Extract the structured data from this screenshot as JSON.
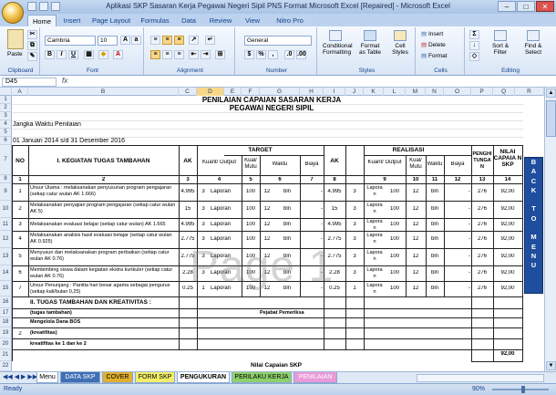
{
  "window": {
    "title": "Aplikasi SKP Sasaran Kerja Pegawai Negeri Sipil PNS Format Microsoft Excel [Repaired] - Microsoft Excel"
  },
  "ribbon_tabs": [
    "Home",
    "Insert",
    "Page Layout",
    "Formulas",
    "Data",
    "Review",
    "View",
    "Nitro Pro"
  ],
  "ribbon": {
    "paste": "Paste",
    "font_name": "Cambria",
    "font_size": "10",
    "number_format": "General",
    "groups": [
      "Clipboard",
      "Font",
      "Alignment",
      "Number",
      "Styles",
      "Cells",
      "Editing"
    ],
    "styles": [
      "Conditional Formatting",
      "Format as Table",
      "Cell Styles"
    ],
    "cells": [
      "Insert",
      "Delete",
      "Format"
    ],
    "editing": [
      "Sort & Filter",
      "Find & Select"
    ]
  },
  "formula_bar": {
    "name_box": "D45",
    "fx": "fx",
    "content": ""
  },
  "columns": [
    "A",
    "B",
    "C",
    "D",
    "E",
    "F",
    "G",
    "H",
    "I",
    "J",
    "K",
    "L",
    "M",
    "N",
    "O",
    "P",
    "Q",
    "R"
  ],
  "selected_column": "D",
  "rows": [
    "1",
    "2",
    "3",
    "4",
    "5",
    "6",
    "7",
    "8",
    "9",
    "10",
    "11",
    "12",
    "13",
    "14",
    "15",
    "16",
    "17",
    "18",
    "19",
    "20",
    "21",
    "22"
  ],
  "sheet": {
    "title1": "PENILAIAN CAPAIAN SASARAN KERJA",
    "title2": "PEGAWAI NEGERI SIPIL",
    "jangka_label": "Jangka Waktu Penilaian",
    "jangka_value": "01 Januari 2014 s/d 31 Desember 2016",
    "headers": {
      "no": "NO",
      "kegiatan": "I. KEGIATAN TUGAS TAMBAHAN",
      "ak": "AK",
      "target": "TARGET",
      "realisasi": "REALISASI",
      "kuant": "Kuant/ Output",
      "kual": "Kual/ Mutu",
      "waktu": "Waktu",
      "biaya": "Biaya",
      "penghitungan": "PENGHI TUNGA N",
      "nilai": "NILAI CAPAIA N SKP"
    },
    "colnums": [
      "1",
      "2",
      "3",
      "4",
      "5",
      "6",
      "7",
      "8",
      "9",
      "10",
      "11",
      "12",
      "13",
      "14"
    ],
    "tasks": [
      {
        "no": "1",
        "name": "Unsur Utama : melaksanakan penyusunan program pengajaran (setiap catur wulan AK 1.666)",
        "ak": "4.995",
        "kuant": "3",
        "unit": "Laporan",
        "kual": "100",
        "waktu": "12",
        "wunit": "bln",
        "biaya": "-",
        "rak": "4.995",
        "rkuant": "3",
        "runit": "Lapora n",
        "rkual": "100",
        "rwaktu": "12",
        "rwunit": "bln",
        "rbiaya": "-",
        "hitung": "276",
        "nilai": "92,00"
      },
      {
        "no": "2",
        "name": "Melaksanakan penyajian program pengajaran (setiap catur wulan AK 5)",
        "ak": "15",
        "kuant": "3",
        "unit": "Laporan",
        "kual": "100",
        "waktu": "12",
        "wunit": "bln",
        "biaya": "-",
        "rak": "15",
        "rkuant": "3",
        "runit": "Lapora n",
        "rkual": "100",
        "rwaktu": "12",
        "rwunit": "bln",
        "rbiaya": "-",
        "hitung": "276",
        "nilai": "92,00"
      },
      {
        "no": "3",
        "name": "Melaksanakan evaluasi belajar (setiap catur wulan) AK 1.665",
        "ak": "4.995",
        "kuant": "3",
        "unit": "Laporan",
        "kual": "100",
        "waktu": "12",
        "wunit": "bln",
        "biaya": "-",
        "rak": "4.995",
        "rkuant": "3",
        "runit": "Lapora n",
        "rkual": "100",
        "rwaktu": "12",
        "rwunit": "bln",
        "rbiaya": "-",
        "hitung": "276",
        "nilai": "92,00"
      },
      {
        "no": "4",
        "name": "Melaksanakan analisis hasil evaluasi belajar (setiap catur wulan AK 0.925)",
        "ak": "2.775",
        "kuant": "3",
        "unit": "Laporan",
        "kual": "100",
        "waktu": "12",
        "wunit": "bln",
        "biaya": "-",
        "rak": "2.775",
        "rkuant": "3",
        "runit": "Lapora n",
        "rkual": "100",
        "rwaktu": "12",
        "rwunit": "bln",
        "rbiaya": "-",
        "hitung": "276",
        "nilai": "92,00"
      },
      {
        "no": "5",
        "name": "Menyusun dan melaksanakan program perbaikan (setiap catur wulan AK 0.76)",
        "ak": "2.775",
        "kuant": "3",
        "unit": "Laporan",
        "kual": "100",
        "waktu": "12",
        "wunit": "bln",
        "biaya": "-",
        "rak": "2.775",
        "rkuant": "3",
        "runit": "Lapora n",
        "rkual": "100",
        "rwaktu": "12",
        "rwunit": "bln",
        "rbiaya": "-",
        "hitung": "276",
        "nilai": "92,00"
      },
      {
        "no": "6",
        "name": "Membimbing siswa dalam kegiatan ekstra kurikuler (setiap catur wulan AK 0.76)",
        "ak": "2.28",
        "kuant": "3",
        "unit": "Laporan",
        "kual": "100",
        "waktu": "12",
        "wunit": "bln",
        "biaya": "-",
        "rak": "2.28",
        "rkuant": "3",
        "runit": "Lapora n",
        "rkual": "100",
        "rwaktu": "12",
        "rwunit": "bln",
        "rbiaya": "-",
        "hitung": "276",
        "nilai": "92,00"
      },
      {
        "no": "7",
        "name": "Unsur Penunjang : Panitia hari besar agama sebagai pengurus (setiap kali/bulan 0,25)",
        "ak": "0.25",
        "kuant": "1",
        "unit": "Laporan",
        "kual": "100",
        "waktu": "12",
        "wunit": "bln",
        "biaya": "-",
        "rak": "0.25",
        "rkuant": "1",
        "runit": "Lapora n",
        "rkual": "100",
        "rwaktu": "12",
        "rwunit": "bln",
        "rbiaya": "-",
        "hitung": "276",
        "nilai": "92,00"
      }
    ],
    "section2": "II. TUGAS TAMBAHAN DAN KREATIVITAS :",
    "tugas_tambahan": "(tugas tambahan)",
    "pejabat": "Pejabat Pemeriksa",
    "mengelola": "Mengelola Dana BOS",
    "no2": "2",
    "kreatifitas": "(kreatifitas)",
    "kreatifitas_ke": "kreatifitas ke 1 dan ke 2",
    "nilai_total": "92,00",
    "nilai_capaian": "Nilai Capaian SKP"
  },
  "watermark": "Page 1",
  "back_to_menu": [
    "B",
    "A",
    "C",
    "K",
    "",
    "T",
    "O",
    "",
    "M",
    "E",
    "N",
    "U"
  ],
  "sheet_tabs": [
    {
      "label": "Menu",
      "color": "#ffffff"
    },
    {
      "label": "DATA SKP",
      "color": "#3f6fb5"
    },
    {
      "label": "COVER",
      "color": "#e0b030"
    },
    {
      "label": "FORM SKP",
      "color": "#f2ee6b"
    },
    {
      "label": "PENGUKURAN",
      "color": "#ffffff"
    },
    {
      "label": "PERILAKU KERJA",
      "color": "#8fd16b"
    },
    {
      "label": "PENILAIAN",
      "color": "#e99ad8"
    }
  ],
  "status": {
    "ready": "Ready",
    "zoom": "90%"
  }
}
